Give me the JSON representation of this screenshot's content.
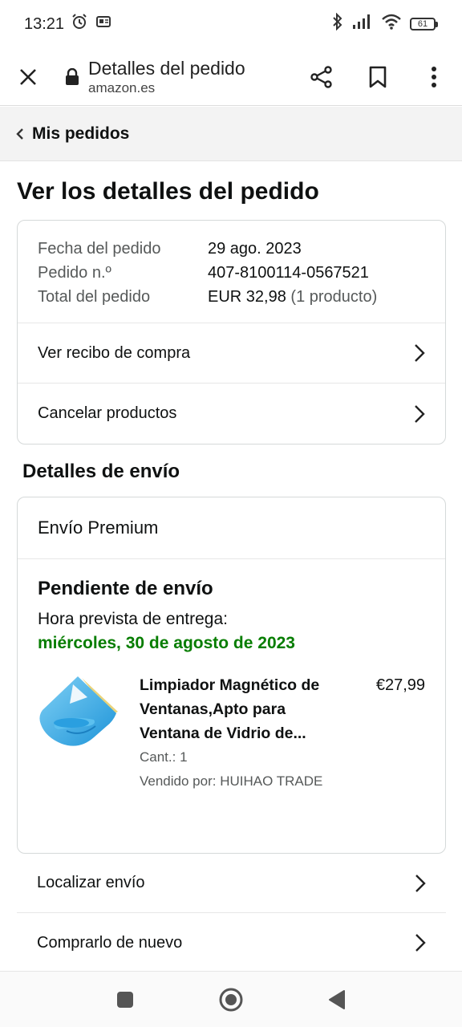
{
  "status_bar": {
    "time": "13:21",
    "battery": "61",
    "icons": [
      "alarm-icon",
      "notification-icon",
      "bluetooth-icon",
      "signal-icon",
      "wifi-icon",
      "battery-icon"
    ]
  },
  "browser": {
    "page_title": "Detalles del pedido",
    "url": "amazon.es",
    "icons": [
      "close-icon",
      "lock-icon",
      "share-icon",
      "bookmark-icon",
      "more-vert-icon"
    ]
  },
  "breadcrumb": {
    "label": "Mis pedidos"
  },
  "main": {
    "title": "Ver los detalles del pedido"
  },
  "order_summary": {
    "date_label": "Fecha del pedido",
    "date_value": "29 ago. 2023",
    "number_label": "Pedido n.º",
    "number_value": "407-8100114-0567521",
    "total_label": "Total del pedido",
    "total_value": "EUR 32,98",
    "total_items": "(1 producto)",
    "links": [
      {
        "label": "Ver recibo de compra"
      },
      {
        "label": "Cancelar productos"
      }
    ]
  },
  "shipping": {
    "section_title": "Detalles de envío",
    "method": "Envío Premium",
    "status": "Pendiente de envío",
    "delivery_label": "Hora prevista de entrega:",
    "delivery_date": "miércoles, 30 de agosto de 2023",
    "accent_color": "#067d00",
    "product": {
      "name": "Limpiador Magnético de Ventanas,Apto para Ventana de Vidrio de...",
      "price": "€27,99",
      "quantity": "Cant.: 1",
      "seller": "Vendido por: HUIHAO TRADE"
    }
  },
  "bottom_links": [
    {
      "label": "Localizar envío"
    },
    {
      "label": "Comprarlo de nuevo"
    }
  ],
  "nav_bar": {
    "icons": [
      "recent-apps-icon",
      "home-icon",
      "back-icon"
    ]
  }
}
